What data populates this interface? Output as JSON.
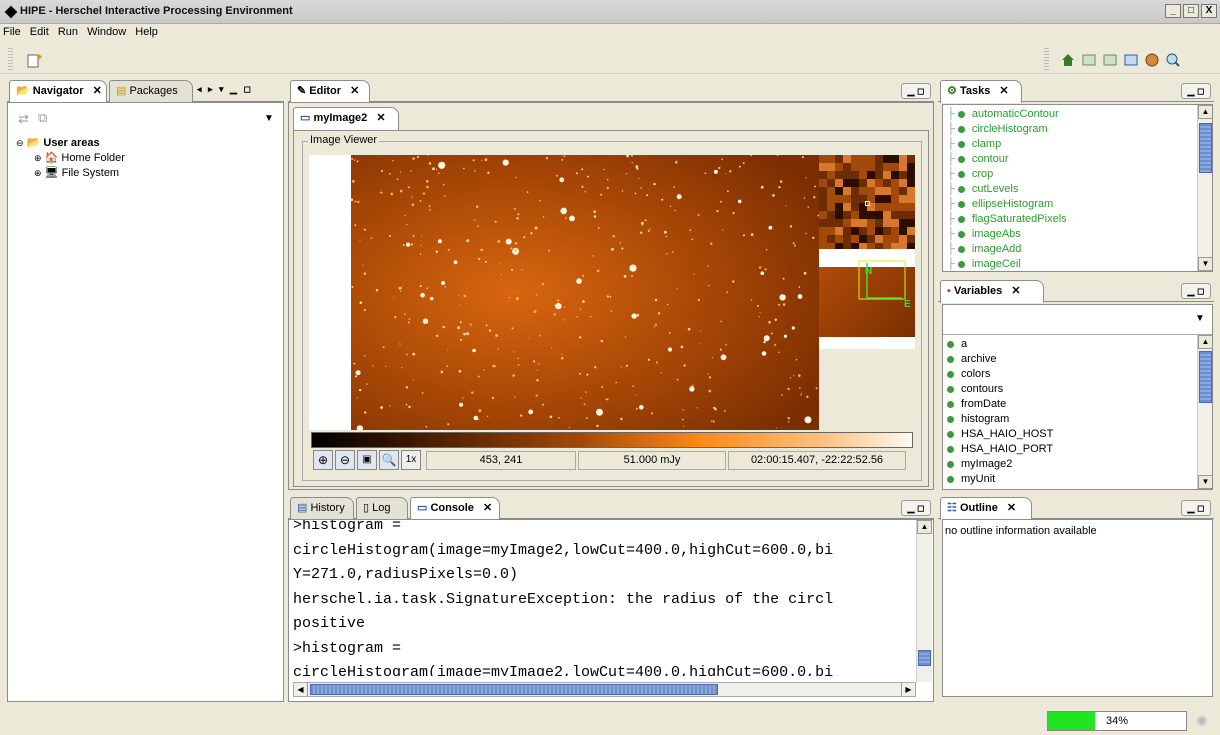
{
  "window": {
    "title": "HIPE - Herschel Interactive Processing Environment",
    "min": "_",
    "max": "□",
    "close": "X"
  },
  "menu": [
    "File",
    "Edit",
    "Run",
    "Window",
    "Help"
  ],
  "navigator": {
    "tabs": [
      {
        "label": "Navigator",
        "close": "✕"
      },
      {
        "label": "Packages"
      }
    ],
    "tree": [
      {
        "label": "User areas"
      },
      {
        "label": "Home Folder"
      },
      {
        "label": "File System"
      }
    ]
  },
  "editor": {
    "tab_label": "Editor",
    "close": "✕",
    "subtab_label": "myImage2",
    "group_label": "Image Viewer",
    "coords": "453, 241",
    "value": "51.000 mJy",
    "radec": "02:00:15.407, -22:22:52.56",
    "zoom_label": "1x",
    "compass_n": "N",
    "compass_e": "E"
  },
  "tasks": {
    "tab_label": "Tasks",
    "items": [
      "automaticContour",
      "circleHistogram",
      "clamp",
      "contour",
      "crop",
      "cutLevels",
      "ellipseHistogram",
      "flagSaturatedPixels",
      "imageAbs",
      "imageAdd",
      "imageCeil"
    ]
  },
  "variables": {
    "tab_label": "Variables",
    "items": [
      "a",
      "archive",
      "colors",
      "contours",
      "fromDate",
      "histogram",
      "HSA_HAIO_HOST",
      "HSA_HAIO_PORT",
      "myImage2",
      "myUnit"
    ]
  },
  "console": {
    "tabs": [
      {
        "label": "History"
      },
      {
        "label": "Log"
      },
      {
        "label": "Console"
      }
    ],
    "lines": [
      ">histogram =",
      "circleHistogram(image=myImage2,lowCut=400.0,highCut=600.0,bi",
      "Y=271.0,radiusPixels=0.0)",
      "herschel.ia.task.SignatureException: the radius of the circl",
      "positive",
      ">histogram =",
      "circleHistogram(image=myImage2,lowCut=400.0,highCut=600.0,bi"
    ]
  },
  "outline": {
    "tab_label": "Outline",
    "message": "no outline information available"
  },
  "status": {
    "progress_label": "34%",
    "progress": 0.34
  },
  "colors": {
    "accent_green": "#2e9b2e",
    "progress_green": "#21e521",
    "title_blue": "#0a246a"
  }
}
